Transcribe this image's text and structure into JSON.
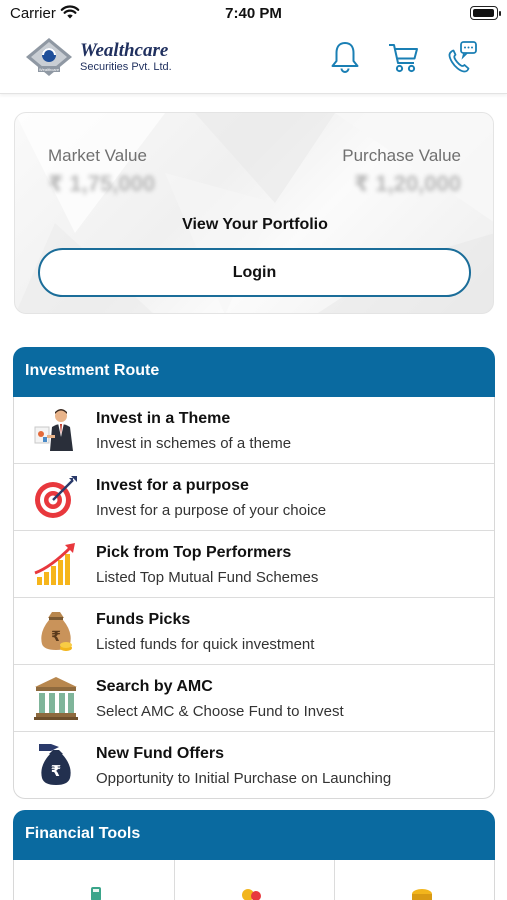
{
  "status_bar": {
    "carrier": "Carrier",
    "time": "7:40 PM"
  },
  "header": {
    "brand_name": "Wealthcare",
    "brand_subtitle": "Securities Pvt. Ltd.",
    "logo_text": "Wealthcare",
    "icons": [
      "bell-icon",
      "cart-icon",
      "phone-chat-icon"
    ]
  },
  "portfolio": {
    "market_value_label": "Market Value",
    "market_value": "₹ 1,75,000",
    "purchase_value_label": "Purchase Value",
    "purchase_value": "₹ 1,20,000",
    "view_portfolio": "View Your Portfolio",
    "login_label": "Login"
  },
  "investment_route": {
    "title": "Investment Route",
    "items": [
      {
        "title": "Invest in a Theme",
        "subtitle": "Invest in schemes of a theme",
        "icon": "presenter-icon"
      },
      {
        "title": "Invest for a purpose",
        "subtitle": "Invest for a purpose of your choice",
        "icon": "target-icon"
      },
      {
        "title": "Pick from Top Performers",
        "subtitle": "Listed Top Mutual Fund Schemes",
        "icon": "growth-chart-icon"
      },
      {
        "title": "Funds Picks",
        "subtitle": "Listed funds for quick investment",
        "icon": "money-bag-icon"
      },
      {
        "title": "Search by AMC",
        "subtitle": "Select AMC & Choose Fund to Invest",
        "icon": "bank-icon"
      },
      {
        "title": "New Fund Offers",
        "subtitle": "Opportunity to Initial Purchase on Launching",
        "icon": "nfo-bag-icon"
      }
    ]
  },
  "financial_tools": {
    "title": "Financial Tools",
    "icons": [
      "calculator-icon",
      "coins-icon",
      "coin-stack-icon"
    ]
  },
  "colors": {
    "accent": "#0a6aa0",
    "login_border": "#1b6d99",
    "brand": "#1f2f5e"
  }
}
